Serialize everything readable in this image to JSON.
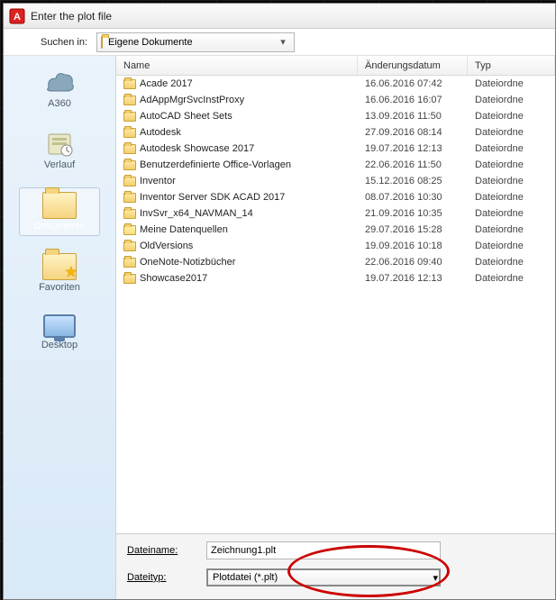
{
  "window": {
    "title": "Enter the plot file"
  },
  "toolbar": {
    "look_in_label": "Suchen in:",
    "look_in_value": "Eigene Dokumente"
  },
  "places": [
    {
      "key": "a360",
      "label": "A360"
    },
    {
      "key": "verlauf",
      "label": "Verlauf"
    },
    {
      "key": "dokumente",
      "label": "Dokumente",
      "selected": true
    },
    {
      "key": "favoriten",
      "label": "Favoriten"
    },
    {
      "key": "desktop",
      "label": "Desktop"
    }
  ],
  "columns": {
    "name": "Name",
    "modified": "Änderungsdatum",
    "type": "Typ"
  },
  "rows": [
    {
      "name": "Acade 2017",
      "mod": "16.06.2016 07:42",
      "type": "Dateiordne",
      "icon": "folder"
    },
    {
      "name": "AdAppMgrSvcInstProxy",
      "mod": "16.06.2016 16:07",
      "type": "Dateiordne",
      "icon": "folder"
    },
    {
      "name": "AutoCAD Sheet Sets",
      "mod": "13.09.2016 11:50",
      "type": "Dateiordne",
      "icon": "folder"
    },
    {
      "name": "Autodesk",
      "mod": "27.09.2016 08:14",
      "type": "Dateiordne",
      "icon": "folder"
    },
    {
      "name": "Autodesk Showcase 2017",
      "mod": "19.07.2016 12:13",
      "type": "Dateiordne",
      "icon": "folder"
    },
    {
      "name": "Benutzerdefinierte Office-Vorlagen",
      "mod": "22.06.2016 11:50",
      "type": "Dateiordne",
      "icon": "folder"
    },
    {
      "name": "Inventor",
      "mod": "15.12.2016 08:25",
      "type": "Dateiordne",
      "icon": "folder"
    },
    {
      "name": "Inventor Server SDK ACAD 2017",
      "mod": "08.07.2016 10:30",
      "type": "Dateiordne",
      "icon": "folder"
    },
    {
      "name": "InvSvr_x64_NAVMAN_14",
      "mod": "21.09.2016 10:35",
      "type": "Dateiordne",
      "icon": "folder"
    },
    {
      "name": "Meine Datenquellen",
      "mod": "29.07.2016 15:28",
      "type": "Dateiordne",
      "icon": "folder-db"
    },
    {
      "name": "OldVersions",
      "mod": "19.09.2016 10:18",
      "type": "Dateiordne",
      "icon": "folder"
    },
    {
      "name": "OneNote-Notizbücher",
      "mod": "22.06.2016 09:40",
      "type": "Dateiordne",
      "icon": "folder"
    },
    {
      "name": "Showcase2017",
      "mod": "19.07.2016 12:13",
      "type": "Dateiordne",
      "icon": "folder"
    }
  ],
  "bottom": {
    "filename_label_pre": "D",
    "filename_label_u": "a",
    "filename_label_post": "teiname:",
    "filename_value": "Zeichnung1.plt",
    "filetype_label_pre": "Datei",
    "filetype_label_u": "t",
    "filetype_label_post": "yp:",
    "filetype_value": "Plotdatei (*.plt)"
  }
}
